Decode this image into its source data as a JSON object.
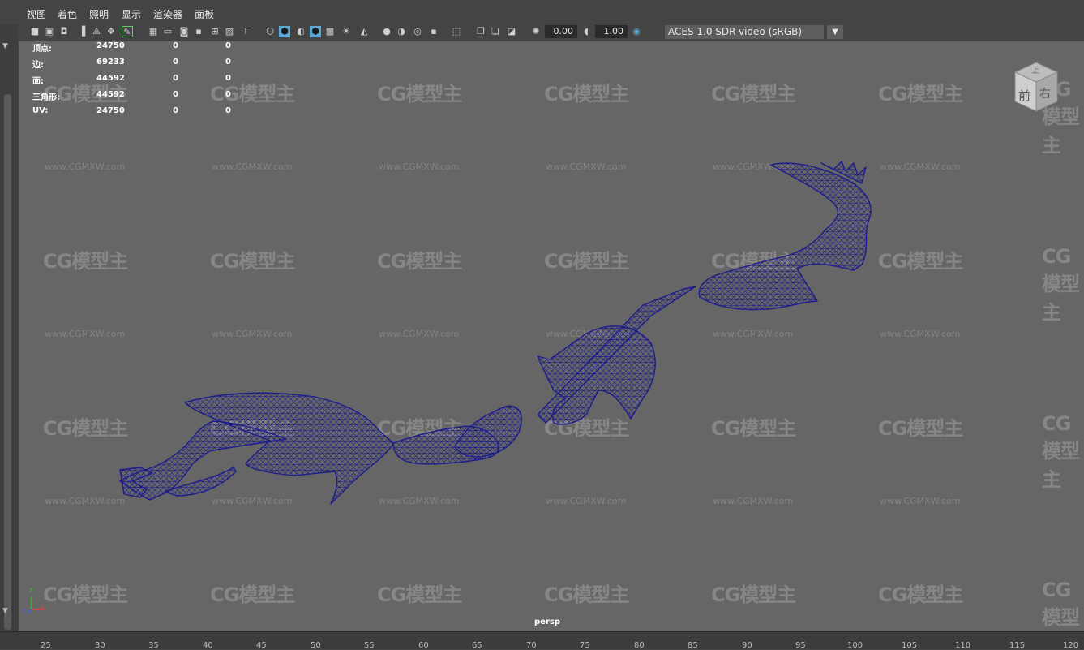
{
  "menu": [
    "视图",
    "着色",
    "照明",
    "显示",
    "渲染器",
    "面板"
  ],
  "toolbar": {
    "exposure": "0.00",
    "gamma": "1.00",
    "color_management": "ACES 1.0 SDR-video (sRGB)"
  },
  "hud": {
    "rows": [
      {
        "label": "顶点:",
        "values": [
          "24750",
          "0",
          "0"
        ]
      },
      {
        "label": "边:",
        "values": [
          "69233",
          "0",
          "0"
        ]
      },
      {
        "label": "面:",
        "values": [
          "44592",
          "0",
          "0"
        ]
      },
      {
        "label": "三角形:",
        "values": [
          "44592",
          "0",
          "0"
        ]
      },
      {
        "label": "UV:",
        "values": [
          "24750",
          "0",
          "0"
        ]
      }
    ]
  },
  "viewcube": {
    "top": "上",
    "front": "前",
    "right": "右"
  },
  "camera": "persp",
  "axis": {
    "x": "x",
    "y": "y",
    "z": "z"
  },
  "watermark": {
    "logo": "CG模型主",
    "url": "www.CGMXW.com"
  },
  "timeline": {
    "ticks": [
      "25",
      "30",
      "35",
      "40",
      "45",
      "50",
      "55",
      "60",
      "65",
      "70",
      "75",
      "80",
      "85",
      "90",
      "95",
      "100",
      "105",
      "110",
      "115",
      "120"
    ]
  },
  "colors": {
    "wireframe": "#1c1c8c",
    "viewport_bg": "#666666"
  }
}
